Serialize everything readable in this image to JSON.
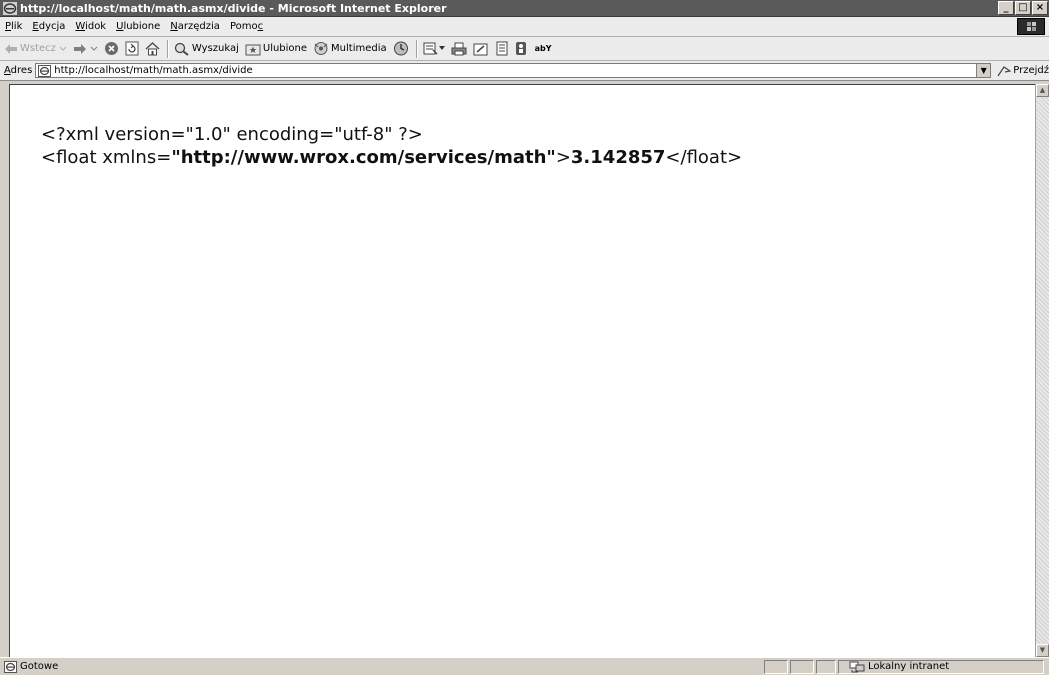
{
  "window": {
    "title": "http://localhost/math/math.asmx/divide - Microsoft Internet Explorer",
    "controls": {
      "minimize": "_",
      "maximize": "□",
      "close": "×"
    }
  },
  "menu": {
    "items": [
      {
        "pre": "",
        "key": "P",
        "post": "lik"
      },
      {
        "pre": "",
        "key": "E",
        "post": "dycja"
      },
      {
        "pre": "",
        "key": "W",
        "post": "idok"
      },
      {
        "pre": "",
        "key": "U",
        "post": "lubione"
      },
      {
        "pre": "",
        "key": "N",
        "post": "arzędzia"
      },
      {
        "pre": "Pomo",
        "key": "c",
        "post": ""
      }
    ]
  },
  "toolbar": {
    "back_label": "Wstecz",
    "search_label": "Wyszukaj",
    "favorites_label": "Ulubione",
    "media_label": "Multimedia",
    "translate_label": "abY"
  },
  "address": {
    "label_key": "A",
    "label_rest": "dres",
    "url": "http://localhost/math/math.asmx/divide",
    "go_label": "Przejdź"
  },
  "document": {
    "declaration": "<?xml version=\"1.0\" encoding=\"utf-8\" ?>",
    "open_tag_start": "<float xmlns=",
    "namespace_quote": "\"",
    "namespace": "http://www.wrox.com/services/math",
    "open_tag_end": ">",
    "value": "3.142857",
    "close_tag": "</float>"
  },
  "status": {
    "text": "Gotowe",
    "zone": "Lokalny intranet"
  },
  "colors": {
    "titlebar": "#5a5a5a",
    "chrome": "#d4d0c8",
    "toolbar": "#ececec",
    "content_bg": "#ffffff"
  }
}
